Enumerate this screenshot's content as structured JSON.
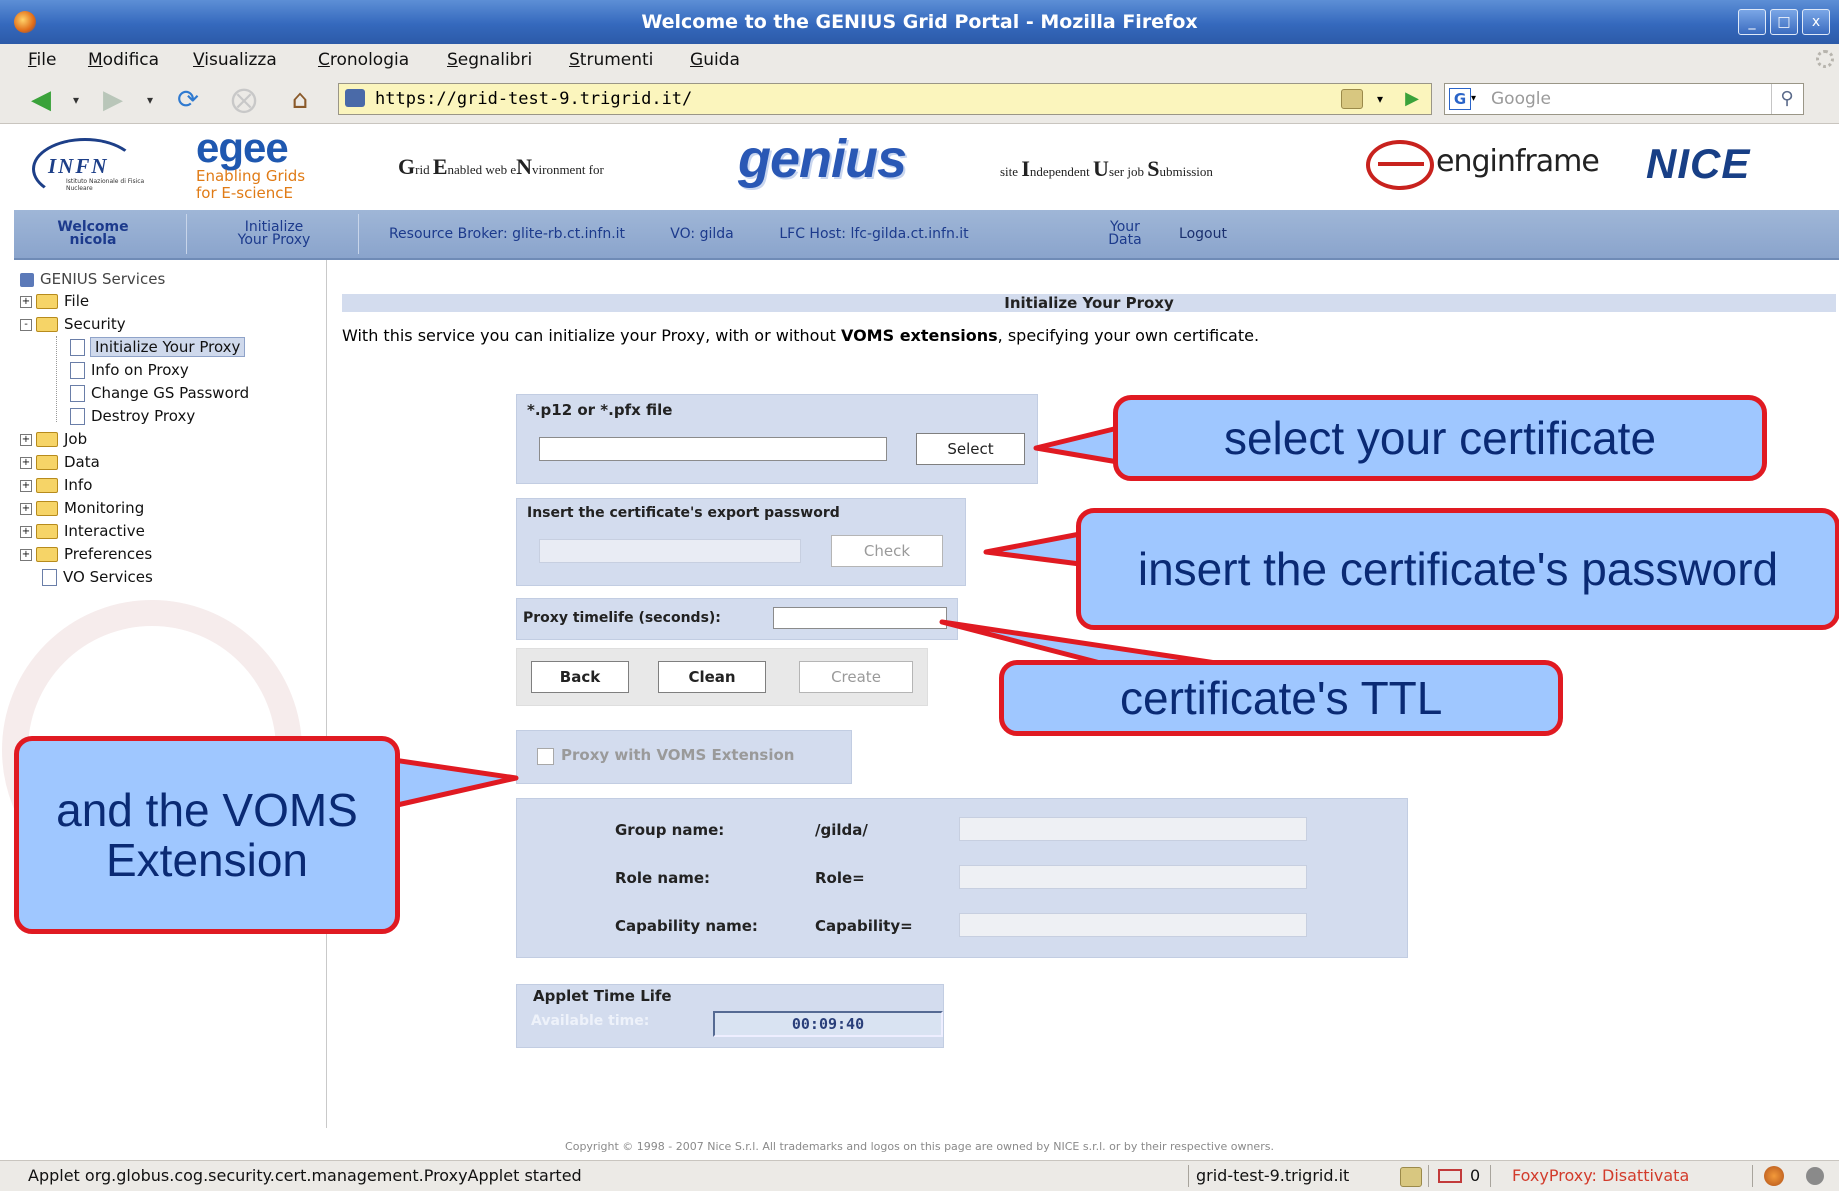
{
  "window": {
    "title": "Welcome to the GENIUS Grid Portal - Mozilla Firefox",
    "controls": [
      "_",
      "□",
      "x"
    ]
  },
  "menubar": {
    "items": [
      {
        "label": "File",
        "u": "F",
        "rest": "ile"
      },
      {
        "label": "Modifica",
        "u": "M",
        "rest": "odifica"
      },
      {
        "label": "Visualizza",
        "u": "V",
        "rest": "isualizza"
      },
      {
        "label": "Cronologia",
        "u": "C",
        "rest": "ronologia"
      },
      {
        "label": "Segnalibri",
        "u": "S",
        "rest": "egnalibri"
      },
      {
        "label": "Strumenti",
        "u": "S",
        "rest": "trumenti"
      },
      {
        "label": "Guida",
        "u": "G",
        "rest": "uida"
      }
    ]
  },
  "navbar": {
    "url": "https://grid-test-9.trigrid.it/",
    "search_placeholder": "Google"
  },
  "banner": {
    "infn": "INFN",
    "infn_sub": "Istituto Nazionale di Fisica Nucleare",
    "egee": "egee",
    "egee_sub1": "Enabling Grids",
    "egee_sub2": "for E-sciencE",
    "grid_env": {
      "G": "G",
      "g_rest": "rid ",
      "E": "E",
      "e_rest": "nabled web e",
      "N": "N",
      "n_rest": "vironment for"
    },
    "genius": "genius",
    "site_ind": {
      "pre": "site ",
      "I": "I",
      "i_rest": "ndependent ",
      "U": "U",
      "u_rest": "ser job ",
      "S": "S",
      "s_rest": "ubmission"
    },
    "enginframe": "enginframe",
    "nice": "NICE"
  },
  "tabs": {
    "welcome_line1": "Welcome",
    "welcome_line2": "nicola",
    "init_line1": "Initialize",
    "init_line2": "Your Proxy",
    "resource_broker": "Resource Broker: glite-rb.ct.infn.it",
    "vo": "VO: gilda",
    "lfc": "LFC Host: lfc-gilda.ct.infn.it",
    "data_line1": "Your",
    "data_line2": "Data",
    "logout": "Logout"
  },
  "sidebar": {
    "root": "GENIUS Services",
    "items": [
      {
        "label": "File",
        "pm": "+"
      },
      {
        "label": "Security",
        "pm": "-"
      },
      {
        "label": "Initialize Your Proxy"
      },
      {
        "label": "Info on Proxy"
      },
      {
        "label": "Change GS Password"
      },
      {
        "label": "Destroy Proxy"
      },
      {
        "label": "Job",
        "pm": "+"
      },
      {
        "label": "Data",
        "pm": "+"
      },
      {
        "label": "Info",
        "pm": "+"
      },
      {
        "label": "Monitoring",
        "pm": "+"
      },
      {
        "label": "Interactive",
        "pm": "+"
      },
      {
        "label": "Preferences",
        "pm": "+"
      },
      {
        "label": "VO Services"
      }
    ]
  },
  "main": {
    "section_title": "Initialize Your Proxy",
    "intro_pre": "With this service you can initialize your Proxy, with or without ",
    "intro_bold": "VOMS extensions",
    "intro_post": ", specifying your own certificate.",
    "file_label": "*.p12 or *.pfx file",
    "select_button": "Select",
    "password_label": "Insert the certificate's export password",
    "check_button": "Check",
    "lifetime_label": "Proxy timelife (seconds):",
    "back_button": "Back",
    "clean_button": "Clean",
    "create_button": "Create",
    "voms_checkbox": "Proxy with VOMS Extension",
    "group_label": "Group name:",
    "group_value": "/gilda/",
    "role_label": "Role name:",
    "role_value": "Role=",
    "capability_label": "Capability name:",
    "capability_value": "Capability=",
    "applet_title": "Applet Time Life",
    "available_label": "Available time:",
    "available_value": "00:09:40"
  },
  "callouts": {
    "certificate": "select your certificate",
    "password": "insert the certificate's password",
    "ttl": "certificate's TTL",
    "voms_line1": "and the VOMS",
    "voms_line2": "Extension"
  },
  "footer": {
    "copyright": "Copyright © 1998 - 2007 Nice S.r.l. All trademarks and logos on this page are owned by NICE s.r.l. or by their respective owners."
  },
  "statusbar": {
    "message": "Applet org.globus.cog.security.cert.management.ProxyApplet started",
    "host": "grid-test-9.trigrid.it",
    "mail_count": "0",
    "foxyproxy": "FoxyProxy: Disattivata"
  },
  "colors": {
    "titlebar": "#3569bd",
    "panel": "#d3dcee",
    "callout_fill": "#9fc7ff",
    "callout_border": "#e01a22",
    "tab_text": "#1c3a8c",
    "foxyproxy": "#d23b2b"
  }
}
